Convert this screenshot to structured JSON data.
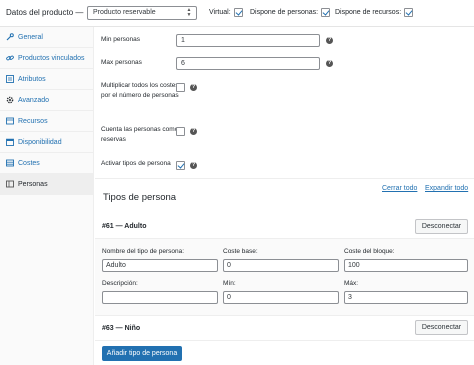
{
  "header": {
    "title": "Datos del producto —",
    "product_type": "Producto reservable",
    "virtual_label": "Virtual:",
    "virtual_checked": true,
    "personas_label": "Dispone de personas:",
    "personas_checked": true,
    "recursos_label": "Dispone de recursos:",
    "recursos_checked": true
  },
  "sidebar": {
    "items": [
      {
        "label": "General",
        "icon": "wrench-icon"
      },
      {
        "label": "Productos vinculados",
        "icon": "link-icon"
      },
      {
        "label": "Atributos",
        "icon": "list-icon"
      },
      {
        "label": "Avanzado",
        "icon": "gear-icon"
      },
      {
        "label": "Recursos",
        "icon": "recursos-icon"
      },
      {
        "label": "Disponibilidad",
        "icon": "calendar-icon"
      },
      {
        "label": "Costes",
        "icon": "costes-icon"
      },
      {
        "label": "Personas",
        "icon": "personas-icon",
        "active": true
      }
    ]
  },
  "persons": {
    "min_label": "Min personas",
    "min_value": "1",
    "max_label": "Max personas",
    "max_value": "6",
    "multiply_label": "Multiplicar todos los costes por el número de personas",
    "multiply_checked": false,
    "count_label": "Cuenta las personas como reservas",
    "count_checked": false,
    "types_label": "Activar tipos de persona",
    "types_checked": true
  },
  "person_types": {
    "title": "Tipos de persona",
    "close_all": "Cerrar todo",
    "expand_all": "Expandir todo",
    "types": [
      {
        "header": "#61 — Adulto",
        "disconnect": "Desconectar",
        "name_label": "Nombre del tipo de persona:",
        "name_value": "Adulto",
        "base_cost_label": "Coste base:",
        "base_cost_value": "0",
        "block_cost_label": "Coste del bloque:",
        "block_cost_value": "100",
        "description_label": "Descripción:",
        "description_value": "",
        "min_label": "Mín:",
        "min_value": "0",
        "max_label": "Máx:",
        "max_value": "3"
      },
      {
        "header": "#63 — Niño",
        "disconnect": "Desconectar"
      }
    ],
    "add_button": "Añadir tipo de persona"
  }
}
